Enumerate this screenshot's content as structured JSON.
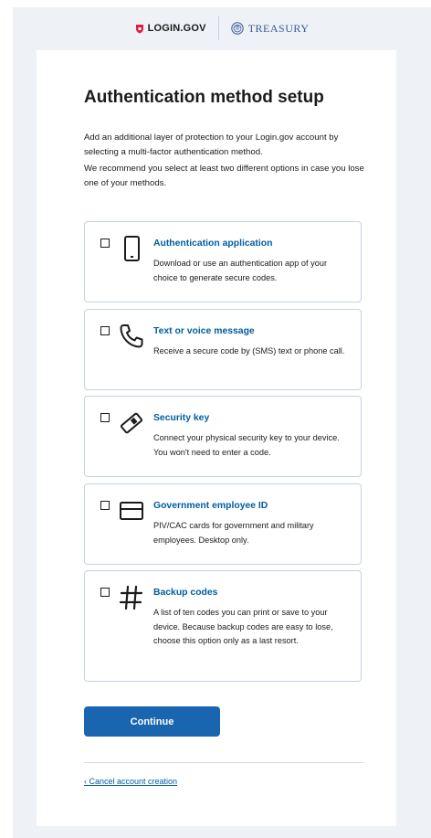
{
  "header": {
    "login_logo": "LOGIN.GOV",
    "agency_logo": "TREASURY"
  },
  "page": {
    "title": "Authentication method setup",
    "intro_1": "Add an additional layer of protection to your Login.gov account by selecting a multi-factor authentication method.",
    "intro_2": "We recommend you select at least two different options in case you lose one of your methods."
  },
  "options": [
    {
      "title": "Authentication application",
      "description": "Download or use an authentication app of your choice to generate secure codes.",
      "icon": "phone-device-icon",
      "checked": false
    },
    {
      "title": "Text or voice message",
      "description": "Receive a secure code by (SMS) text or phone call.",
      "icon": "phone-handset-icon",
      "checked": false
    },
    {
      "title": "Security key",
      "description": "Connect your physical security key to your device. You won't need to enter a code.",
      "icon": "security-key-icon",
      "checked": false
    },
    {
      "title": "Government employee ID",
      "description": "PIV/CAC cards for government and military employees. Desktop only.",
      "icon": "id-card-icon",
      "checked": false
    },
    {
      "title": "Backup codes",
      "description": "A list of ten codes you can print or save to your device. Because backup codes are easy to lose, choose this option only as a last resort.",
      "icon": "hashtag-icon",
      "checked": false
    }
  ],
  "actions": {
    "continue_label": "Continue",
    "cancel_label": "‹ Cancel account creation"
  },
  "colors": {
    "brand_blue": "#005ea2",
    "button_blue": "#1a65b0",
    "login_red": "#e21c3d"
  }
}
